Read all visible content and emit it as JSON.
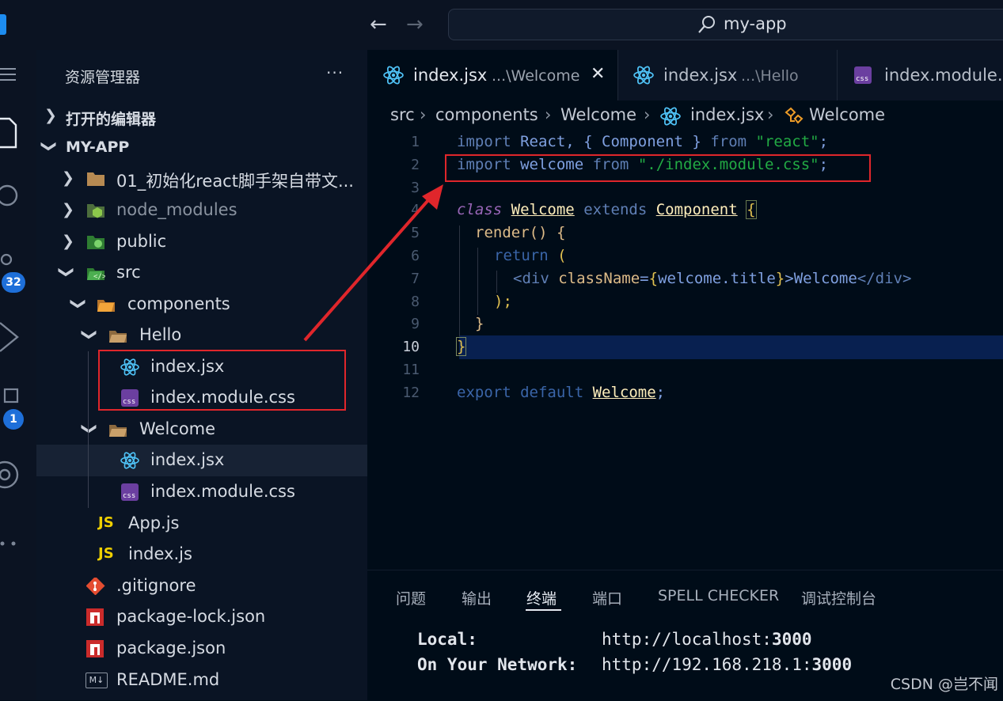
{
  "titlebar": {
    "search_text": "my-app"
  },
  "activity": {
    "scm_badge": "32",
    "ext_badge": "1"
  },
  "sidebar": {
    "title": "资源管理器",
    "more": "···",
    "open_editors": "打开的编辑器",
    "project": "MY-APP",
    "items": [
      {
        "label": "01_初始化react脚手架自带文..."
      },
      {
        "label": "node_modules"
      },
      {
        "label": "public"
      },
      {
        "label": "src"
      },
      {
        "label": "components"
      },
      {
        "label": "Hello"
      },
      {
        "label": "index.jsx"
      },
      {
        "label": "index.module.css"
      },
      {
        "label": "Welcome"
      },
      {
        "label": "index.jsx"
      },
      {
        "label": "index.module.css"
      },
      {
        "label": "App.js"
      },
      {
        "label": "index.js"
      },
      {
        "label": ".gitignore"
      },
      {
        "label": "package-lock.json"
      },
      {
        "label": "package.json"
      },
      {
        "label": "README.md"
      }
    ],
    "icon_text": {
      "js": "JS",
      "css": "css",
      "md": "M↓"
    }
  },
  "tabs": [
    {
      "name": "index.jsx",
      "desc": "...\\Welcome",
      "close": "✕"
    },
    {
      "name": "index.jsx",
      "desc": "...\\Hello"
    },
    {
      "name": "index.module.css"
    }
  ],
  "breadcrumb": [
    "src",
    "components",
    "Welcome",
    "index.jsx",
    "Welcome"
  ],
  "editor": {
    "line_numbers": [
      "1",
      "2",
      "3",
      "4",
      "5",
      "6",
      "7",
      "8",
      "9",
      "10",
      "11",
      "12"
    ],
    "lines": {
      "l1": {
        "kw": "import",
        "a": " React, { ",
        "b": "Component",
        "c": " } ",
        "from": "from",
        "str": "\"react\"",
        "end": ";"
      },
      "l2": {
        "kw": "import",
        "a": " welcome ",
        "from": "from",
        "str": "\"./index.module.css\"",
        "end": ";"
      },
      "l4": {
        "kw": "class",
        "name": "Welcome",
        "ext": "extends",
        "base": "Component",
        "brace": "{"
      },
      "l5": {
        "text": "render() {"
      },
      "l6": {
        "kw": "return",
        "paren": " ("
      },
      "l7": {
        "open": "<div",
        "attr": " className",
        "eq": "=",
        "lb": "{",
        "expr": "welcome.title",
        "rb": "}",
        "gt": ">",
        "text": "Welcome",
        "close": "</div>"
      },
      "l8": {
        "text": ");"
      },
      "l9": {
        "text": "}"
      },
      "l10": {
        "text": "}"
      },
      "l12": {
        "kw": "export",
        "kw2": " default ",
        "name": "Welcome",
        "end": ";"
      }
    }
  },
  "panel": {
    "tabs": [
      "问题",
      "输出",
      "终端",
      "端口",
      "SPELL CHECKER",
      "调试控制台"
    ],
    "active_tab": "终端",
    "terminal": [
      {
        "label": "Local:",
        "url": "http://localhost:",
        "port": "3000"
      },
      {
        "label": "On Your Network:",
        "url": "http://192.168.218.1:",
        "port": "3000"
      }
    ]
  },
  "watermark": "CSDN @岂不闻",
  "colors": {
    "accent": "#1e6fd9",
    "annotation_red": "#e0262b",
    "react_blue": "#4fc3f7",
    "css_purple": "#6b3fa0",
    "js_yellow": "#f0d000",
    "npm_red": "#cb2b2b"
  }
}
